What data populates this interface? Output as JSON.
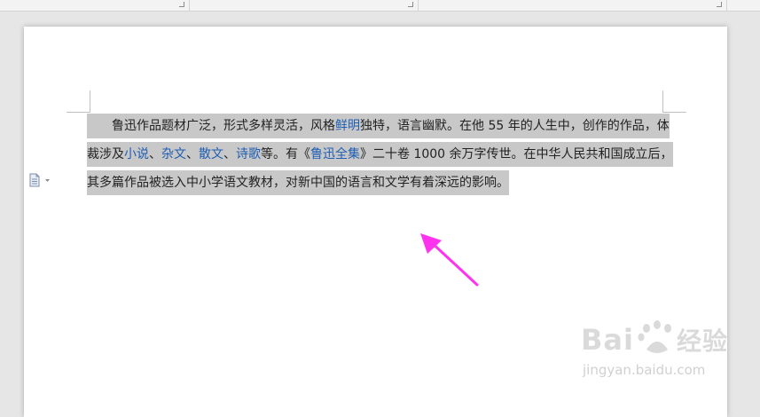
{
  "document": {
    "line1": {
      "t1": "鲁迅作品题材广泛，形式多样灵活，风格",
      "link1": "鲜明",
      "t2": "独特，语言幽默。在他 55 年的人生中，创作的作品，体"
    },
    "line2": {
      "t1": "裁涉及",
      "link1": "小说",
      "sep1": "、",
      "link2": "杂文",
      "sep2": "、",
      "link3": "散文",
      "sep3": "、",
      "link4": "诗歌",
      "t2": "等。有《",
      "link5": "鲁迅全集",
      "t3": "》二十卷 1000 余万字传世。在中华人民共和国成立后，"
    },
    "line3": {
      "t1": "其多篇作品被选入中小学语文教材，对新中国的语言和文学有着深远的影响。"
    }
  },
  "watermark": {
    "brand": "Bai 经验",
    "url": "jingyan.baidu.com"
  },
  "icons": {
    "side": "document-options-icon",
    "arrow": "annotation-arrow"
  },
  "colors": {
    "selection": "#c8c8c8",
    "link": "#1e5eb3",
    "arrow": "#ff33ee"
  }
}
